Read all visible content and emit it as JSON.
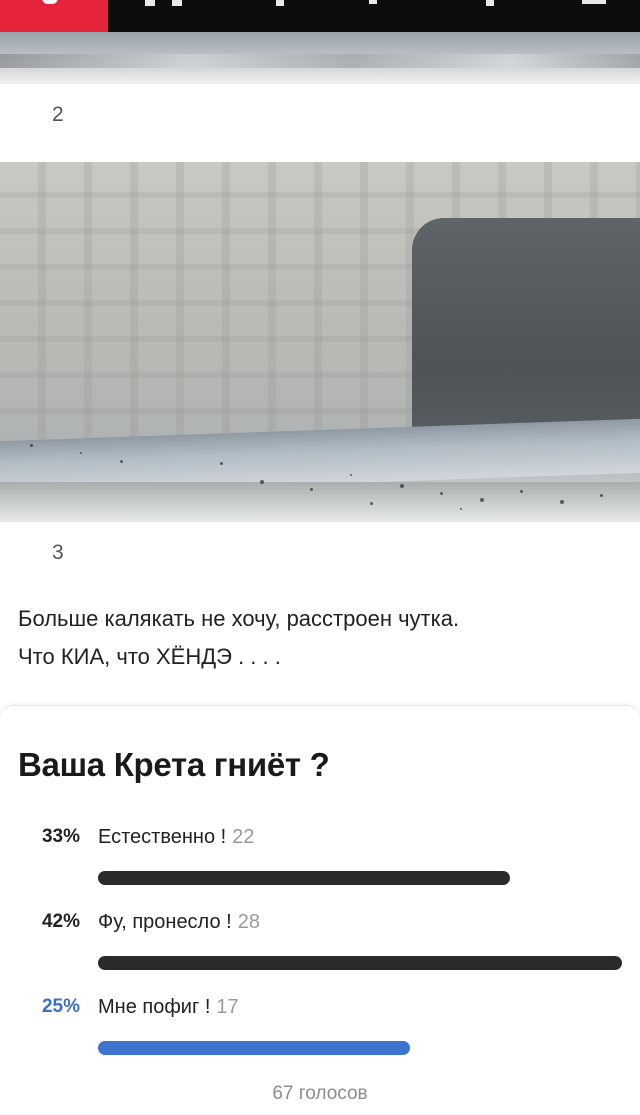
{
  "photos": {
    "caption_2": "2",
    "caption_3": "3"
  },
  "post": {
    "line_1": "Больше калякать не хочу, расстроен чутка.",
    "line_2": "Что КИА, что ХЁНДЭ . . . ."
  },
  "poll": {
    "title": "Ваша Крета гниёт ?",
    "options": [
      {
        "percent": "33%",
        "label": "Естественно !",
        "count": "22",
        "fraction": 0.33
      },
      {
        "percent": "42%",
        "label": "Фу, пронесло !",
        "count": "28",
        "fraction": 0.42
      },
      {
        "percent": "25%",
        "label": "Мне пофиг !",
        "count": "17",
        "fraction": 0.25,
        "selected": true
      }
    ],
    "votes": "67 голосов"
  },
  "colors": {
    "brand_red": "#e5243b",
    "bar_dark": "#2b2b2b",
    "bar_selected": "#3c74cf",
    "selected_text": "#3a6fc4"
  }
}
